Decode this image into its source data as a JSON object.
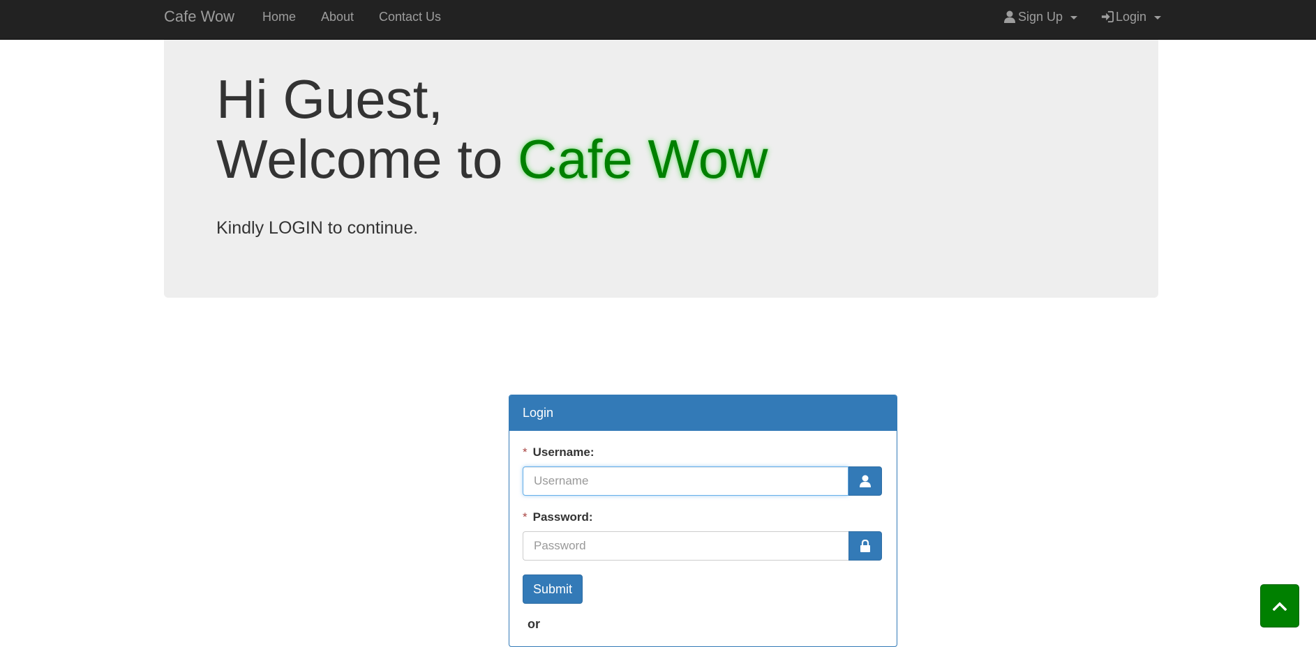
{
  "navbar": {
    "brand": "Cafe Wow",
    "links": {
      "home": "Home",
      "about": "About",
      "contact": "Contact Us"
    },
    "signup_label": "Sign Up",
    "login_label": "Login",
    "signup_icon": "user-icon",
    "login_icon": "log-in-icon"
  },
  "jumbotron": {
    "greeting": "Hi Guest,",
    "welcome_prefix": "Welcome to ",
    "welcome_brand": "Cafe Wow",
    "subtitle": "Kindly LOGIN to continue."
  },
  "login_panel": {
    "heading": "Login",
    "username": {
      "required_mark": "*",
      "label": "Username:",
      "placeholder": "Username",
      "value": "",
      "icon": "user-icon"
    },
    "password": {
      "required_mark": "*",
      "label": "Password:",
      "placeholder": "Password",
      "value": "",
      "icon": "lock-icon"
    },
    "submit_label": "Submit",
    "or_text": "or"
  },
  "scroll_top": {
    "icon": "chevron-up-icon"
  },
  "colors": {
    "navbar_bg": "#222222",
    "nav_text": "#9d9d9d",
    "jumbotron_bg": "#eeeeee",
    "brand_green": "#008000",
    "primary": "#337ab7"
  }
}
